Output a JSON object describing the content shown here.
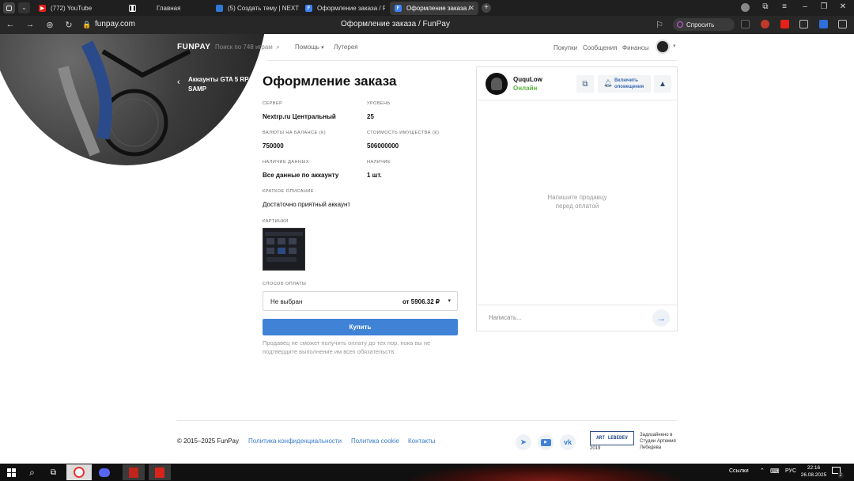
{
  "browser": {
    "tabs": [
      {
        "label": "(772) YouTube",
        "icon": "youtube-icon",
        "color": "#e62117"
      },
      {
        "label": "Главная",
        "icon": "pause-icon",
        "color": "#333"
      },
      {
        "label": "(5) Создать тему | NEXTR",
        "icon": "forum-icon",
        "color": "#2d7ad6"
      },
      {
        "label": "Оформление заказа / Fun",
        "icon": "funpay-icon",
        "color": "#3b82f6"
      },
      {
        "label": "Оформление заказа /",
        "icon": "funpay-icon",
        "color": "#3b82f6"
      }
    ],
    "url": "funpay.com",
    "page_title": "Оформление заказа / FunPay",
    "ask_label": "Спросить"
  },
  "site": {
    "logo": "FUNPAY",
    "search_placeholder": "Поиск по 748 играм",
    "nav": {
      "help": "Помощь",
      "lottery": "Лутерея"
    },
    "nav_right": {
      "purchases": "Покупки",
      "messages": "Сообщения",
      "finances": "Финансы"
    },
    "back_link": "Аккаунты GTA 5 RP, SAMP"
  },
  "order": {
    "title": "Оформление заказа",
    "fields": [
      {
        "label": "Сервер",
        "value": "Nextrp.ru Центральный"
      },
      {
        "label": "Уровень",
        "value": "25"
      },
      {
        "label": "Валюты на балансе (к)",
        "value": "750000"
      },
      {
        "label": "Стоимость имущества (к)",
        "value": "506000000"
      },
      {
        "label": "Наличие данных",
        "value": "Все данные по аккаунту"
      },
      {
        "label": "Наличие",
        "value": "1 шт."
      }
    ],
    "desc_label": "Краткое описание",
    "desc_value": "Достаточно приятный аккаунт",
    "images_label": "Картинки",
    "payment_label": "Способ оплаты",
    "payment_selected": "Не выбран",
    "payment_price": "от 5906.32 ₽",
    "buy_label": "Купить",
    "notice": "Продавец не сможет получить оплату до тех пор, пока вы не подтвердите выполнение им всех обязательств."
  },
  "seller": {
    "name": "QuquLow",
    "status": "Онлайн",
    "notify_label": "Включить оповещения",
    "empty_chat": "Напишите продавцу перед оплатой",
    "message_placeholder": "Написать..."
  },
  "footer": {
    "copyright": "© 2015–2025 FunPay",
    "links": [
      "Политика конфиденциальности",
      "Политика cookie",
      "Контакты"
    ],
    "design_year": "2019",
    "design_by": "Задизайнено в Студии Артемия Лебедева",
    "design_logo": "ART LEBEDEV"
  },
  "taskbar": {
    "links_label": "Ссылки",
    "lang": "РУС",
    "time": "22:16",
    "date": "26.08.2025",
    "notif_count": "2"
  },
  "colors": {
    "accent": "#3f82d6",
    "online": "#58b33e",
    "link": "#3a7bc8"
  }
}
